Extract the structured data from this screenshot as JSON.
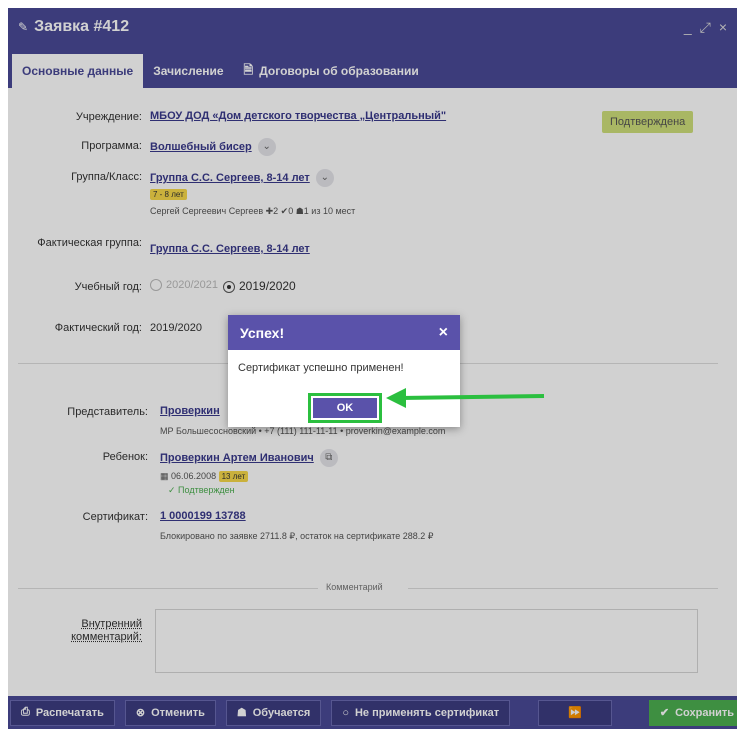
{
  "window": {
    "title": "Заявка #412",
    "controls": [
      "_",
      "⤢",
      "×"
    ]
  },
  "tabs": [
    {
      "label": "Основные данные",
      "active": true
    },
    {
      "label": "Зачисление",
      "active": false
    },
    {
      "label": "Договоры об образовании",
      "active": false
    }
  ],
  "form": {
    "institution_label": "Учреждение:",
    "institution_value": "МБОУ ДОД «Дом детского творчества „Центральный\"",
    "status_badge": "Подтверждена",
    "program_label": "Программа:",
    "program_value": "Волшебный бисер",
    "group_label": "Группа/Класс:",
    "group_value": "Группа С.С. Сергеев, 8-14 лет",
    "group_age_tag": "7 - 8 лет",
    "group_info": "Сергей Сергеевич Сергеев  ✚2  ✔0  ☗1   из 10 мест",
    "actual_group_label": "Фактическая группа:",
    "actual_group_value": "Группа С.С. Сергеев, 8-14 лет",
    "school_year_label": "Учебный год:",
    "school_year_option_1": "2020/2021",
    "school_year_option_2": "2019/2020",
    "actual_year_label": "Фактический год:",
    "actual_year_value": "2019/2020",
    "representative_label": "Представитель:",
    "representative_value": "Проверкин",
    "representative_info": "МР Большесосновский • +7 (111) 111-11-11 • proverkin@example.com",
    "child_label": "Ребенок:",
    "child_value": "Проверкин Артем Иванович",
    "child_dob": "06.06.2008",
    "child_age_tag": "13 лет",
    "child_confirmed": "✓ Подтвержден",
    "certificate_label": "Сертификат:",
    "certificate_value": "1 0000199 13788",
    "certificate_info": "Блокировано по заявке 2711.8 ₽, остаток на сертификате 288.2 ₽",
    "comment_section": "Комментарий",
    "internal_comment_label": "Внутренний комментарий:"
  },
  "footer": {
    "print": "Распечатать",
    "cancel": "Отменить",
    "studying": "Обучается",
    "no_certificate": "Не применять сертификат",
    "next": "⏩",
    "save": "Сохранить"
  },
  "modal": {
    "title": "Успех!",
    "close": "×",
    "message": "Сертификат успешно применен!",
    "ok": "OK"
  },
  "colors": {
    "header": "#4a4a96",
    "modal_header": "#5a52aa",
    "highlight": "#2bbf3f",
    "save": "#4caf50"
  }
}
